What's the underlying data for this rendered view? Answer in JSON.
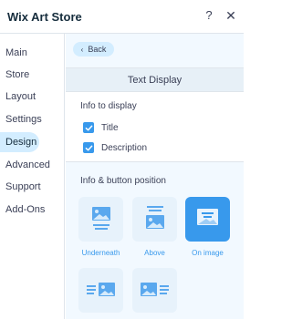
{
  "header": {
    "title": "Wix Art Store",
    "help_label": "?",
    "close_label": "✕"
  },
  "sidebar": {
    "items": [
      {
        "label": "Main"
      },
      {
        "label": "Store"
      },
      {
        "label": "Layout"
      },
      {
        "label": "Settings"
      },
      {
        "label": "Design",
        "active": true
      },
      {
        "label": "Advanced"
      },
      {
        "label": "Support"
      },
      {
        "label": "Add-Ons"
      }
    ]
  },
  "content": {
    "back_label": "Back",
    "section_title": "Text Display",
    "info_label": "Info to display",
    "checkboxes": [
      {
        "label": "Title",
        "checked": true
      },
      {
        "label": "Description",
        "checked": true
      }
    ],
    "position_label": "Info & button position",
    "tiles": [
      {
        "label": "Underneath",
        "icon": "image-text-underneath-icon",
        "selected": false
      },
      {
        "label": "Above",
        "icon": "image-text-above-icon",
        "selected": false
      },
      {
        "label": "On image",
        "icon": "image-text-on-image-icon",
        "selected": true
      },
      {
        "label": "",
        "icon": "image-text-left-icon",
        "selected": false
      },
      {
        "label": "",
        "icon": "image-text-right-icon",
        "selected": false
      }
    ]
  },
  "colors": {
    "accent": "#3899ec",
    "accent_light": "#d3edff",
    "tile_bg": "#e7f2fb",
    "content_bg": "#f2f9ff",
    "text": "#3b4057"
  }
}
